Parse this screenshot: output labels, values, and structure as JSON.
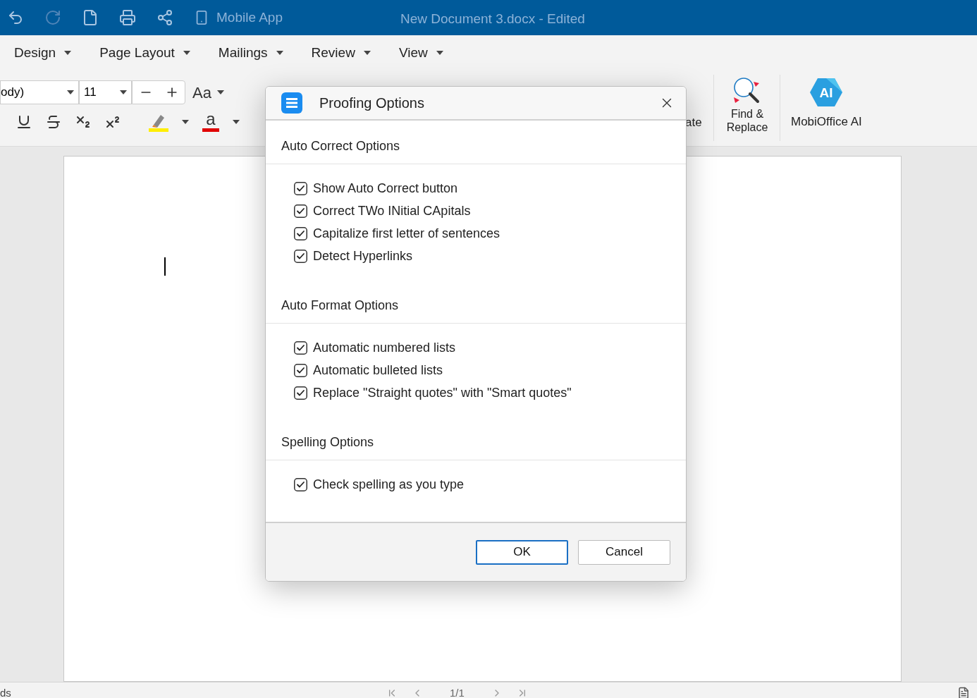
{
  "title_bar": {
    "tools": [
      {
        "kind": "undo",
        "disabled": false
      },
      {
        "kind": "redo",
        "disabled": true
      },
      {
        "kind": "new",
        "disabled": false
      },
      {
        "kind": "print",
        "disabled": false
      },
      {
        "kind": "share",
        "disabled": false
      }
    ],
    "mobile_app": "Mobile App",
    "title": "New Document 3.docx - Edited"
  },
  "menu": [
    {
      "label": "Design"
    },
    {
      "label": "Page Layout"
    },
    {
      "label": "Mailings"
    },
    {
      "label": "Review"
    },
    {
      "label": "View"
    }
  ],
  "toolbar": {
    "font_name": "ody)",
    "font_size": "11",
    "change_case": "Aa",
    "partial_label": "ate",
    "find_replace": "Find & Replace",
    "ai": "MobiOffice AI",
    "ai_badge": "AI",
    "font_color_glyph": "a"
  },
  "dialog": {
    "title": "Proofing Options",
    "sections": [
      {
        "title": "Auto Correct Options",
        "options": [
          {
            "label": "Show Auto Correct button",
            "checked": true
          },
          {
            "label": "Correct TWo INitial CApitals",
            "checked": true
          },
          {
            "label": "Capitalize first letter of sentences",
            "checked": true
          },
          {
            "label": "Detect Hyperlinks",
            "checked": true
          }
        ]
      },
      {
        "title": "Auto Format Options",
        "options": [
          {
            "label": "Automatic numbered lists",
            "checked": true
          },
          {
            "label": "Automatic bulleted lists",
            "checked": true
          },
          {
            "label": "Replace \"Straight quotes\" with \"Smart quotes\"",
            "checked": true
          }
        ]
      },
      {
        "title": "Spelling Options",
        "options": [
          {
            "label": "Check spelling as you type",
            "checked": true
          }
        ]
      }
    ],
    "buttons": [
      {
        "label": "OK",
        "kind": "primary"
      },
      {
        "label": "Cancel",
        "kind": "secondary"
      }
    ]
  },
  "status_bar": {
    "left": "ds",
    "page": "1/1"
  }
}
